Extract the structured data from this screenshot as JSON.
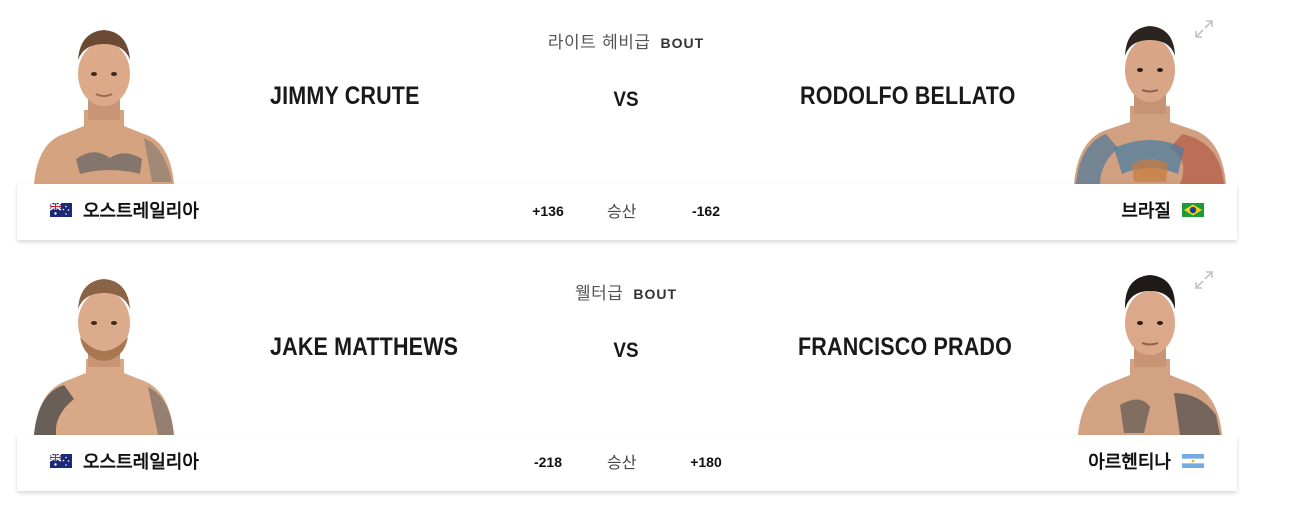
{
  "bouts": [
    {
      "weight_class": "라이트 헤비급",
      "bout_label": "BOUT",
      "fighter_left": {
        "name": "JIMMY CRUTE",
        "country": "오스트레일리아",
        "flag": "australia",
        "odds": "+136"
      },
      "vs_label": "VS",
      "fighter_right": {
        "name": "RODOLFO BELLATO",
        "country": "브라질",
        "flag": "brazil",
        "odds": "-162"
      },
      "odds_label": "승산"
    },
    {
      "weight_class": "웰터급",
      "bout_label": "BOUT",
      "fighter_left": {
        "name": "JAKE MATTHEWS",
        "country": "오스트레일리아",
        "flag": "australia",
        "odds": "-218"
      },
      "vs_label": "VS",
      "fighter_right": {
        "name": "FRANCISCO PRADO",
        "country": "아르헨티나",
        "flag": "argentina",
        "odds": "+180"
      },
      "odds_label": "승산"
    }
  ],
  "colors": {
    "text": "#191919",
    "muted": "#555555",
    "skin": "#d9a684",
    "shadow": "#e6e6e6"
  }
}
